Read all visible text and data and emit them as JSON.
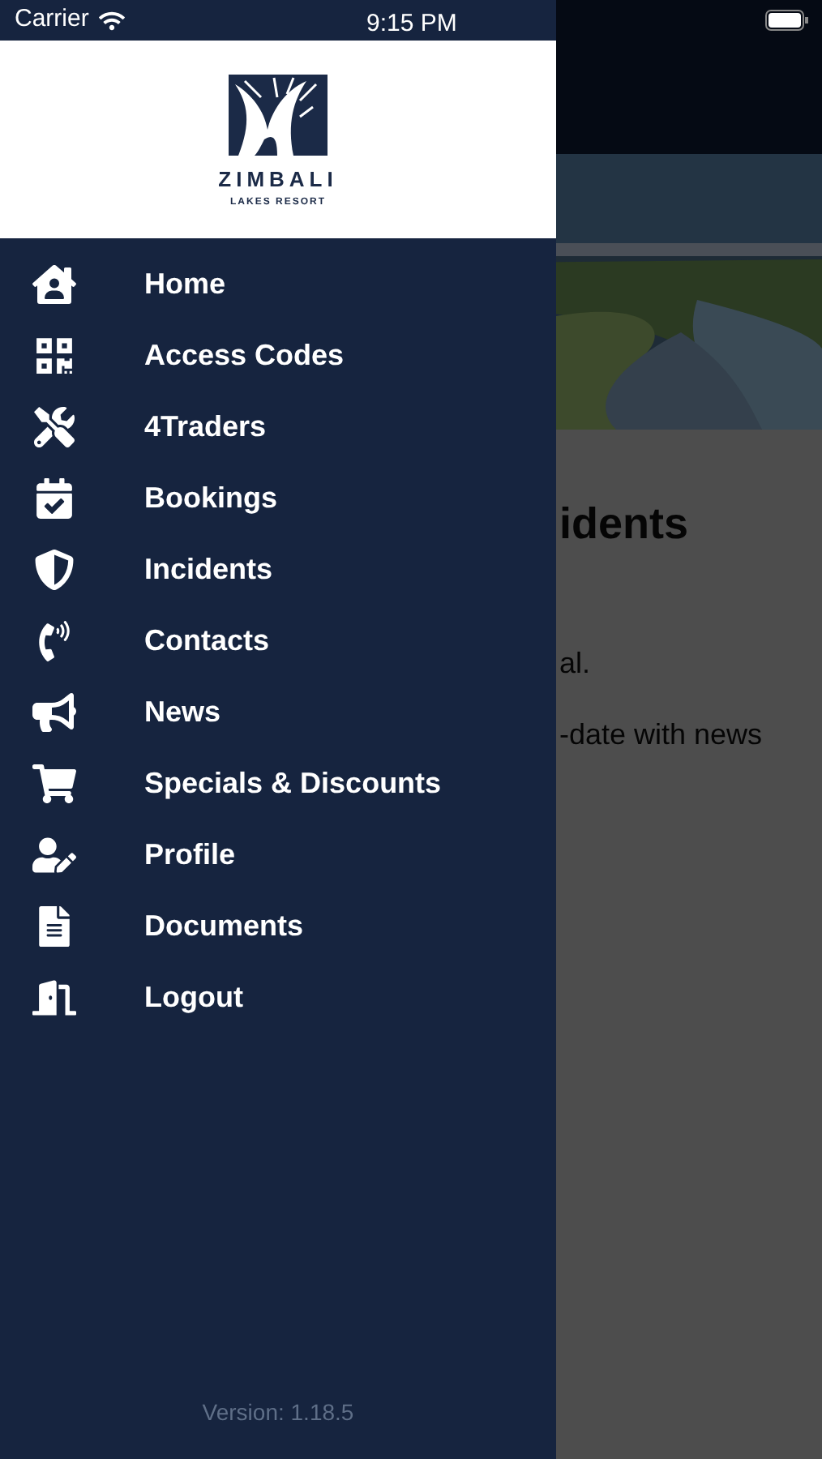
{
  "status_bar": {
    "carrier": "Carrier",
    "time": "9:15 PM"
  },
  "logo": {
    "name": "ZIMBALI",
    "tagline": "LAKES RESORT"
  },
  "menu": [
    {
      "label": "Home",
      "kind": "home"
    },
    {
      "label": "Access Codes",
      "kind": "qr"
    },
    {
      "label": "4Traders",
      "kind": "tools"
    },
    {
      "label": "Bookings",
      "kind": "calendar"
    },
    {
      "label": "Incidents",
      "kind": "shield"
    },
    {
      "label": "Contacts",
      "kind": "phone"
    },
    {
      "label": "News",
      "kind": "bullhorn"
    },
    {
      "label": "Specials & Discounts",
      "kind": "cart"
    },
    {
      "label": "Profile",
      "kind": "profile"
    },
    {
      "label": "Documents",
      "kind": "document"
    },
    {
      "label": "Logout",
      "kind": "logout"
    }
  ],
  "version": "Version: 1.18.5",
  "background_page": {
    "heading": "idents",
    "lines": [
      "al.",
      "-date with news"
    ]
  }
}
